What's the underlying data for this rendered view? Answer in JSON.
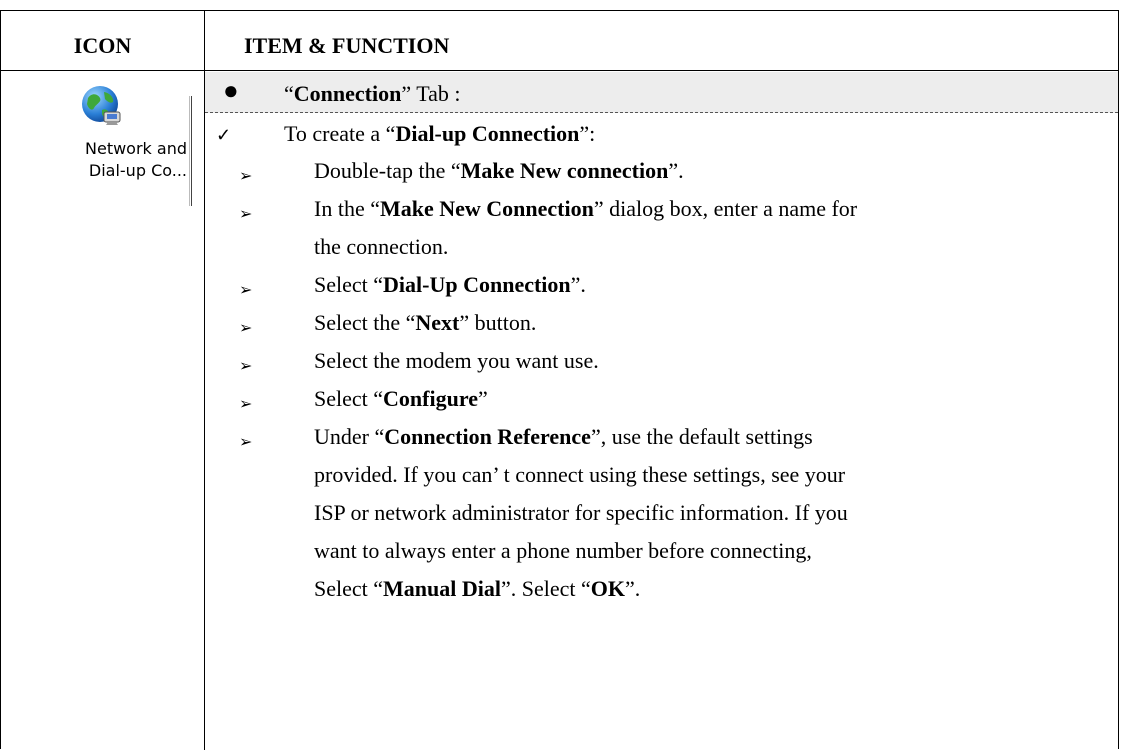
{
  "header": {
    "icon_col": "ICON",
    "item_col": "ITEM & FUNCTION"
  },
  "icon": {
    "name": "network-globe-icon",
    "label_line1": "Network and",
    "label_line2": "Dial-up Co..."
  },
  "tab_heading": {
    "prefix": "“",
    "bold": "Connection",
    "suffix": "” Tab :"
  },
  "intro": {
    "prefix": "To create a “",
    "bold": "Dial-up Connection",
    "suffix": "”:"
  },
  "steps": [
    {
      "lines": [
        {
          "t1": "Double-tap the “",
          "b": "Make New connection",
          "t2": "”."
        }
      ]
    },
    {
      "lines": [
        {
          "t1": "In the “",
          "b": "Make New Connection",
          "t2": "” dialog box, enter a name for"
        },
        {
          "t1": "the connection.",
          "b": "",
          "t2": ""
        }
      ]
    },
    {
      "lines": [
        {
          "t1": "Select “",
          "b": "Dial-Up Connection",
          "t2": "”."
        }
      ]
    },
    {
      "lines": [
        {
          "t1": "Select the “",
          "b": "Next",
          "t2": "” button."
        }
      ]
    },
    {
      "lines": [
        {
          "t1": "Select the modem you want use.",
          "b": "",
          "t2": ""
        }
      ]
    },
    {
      "lines": [
        {
          "t1": "Select “",
          "b": "Configure",
          "t2": "”"
        }
      ]
    },
    {
      "lines": [
        {
          "t1": "Under “",
          "b": "Connection Reference",
          "t2": "”, use the default settings"
        },
        {
          "t1": "provided. If you can’ t connect using these settings, see your",
          "b": "",
          "t2": ""
        },
        {
          "t1": "ISP or network administrator for specific information. If you",
          "b": "",
          "t2": ""
        },
        {
          "t1": "want to always enter a phone number before connecting,",
          "b": "",
          "t2": ""
        },
        {
          "t1": "Select “",
          "b": "Manual Dial",
          "t2": "”. Select “",
          "b2": "OK",
          "t3": "”."
        }
      ]
    }
  ]
}
